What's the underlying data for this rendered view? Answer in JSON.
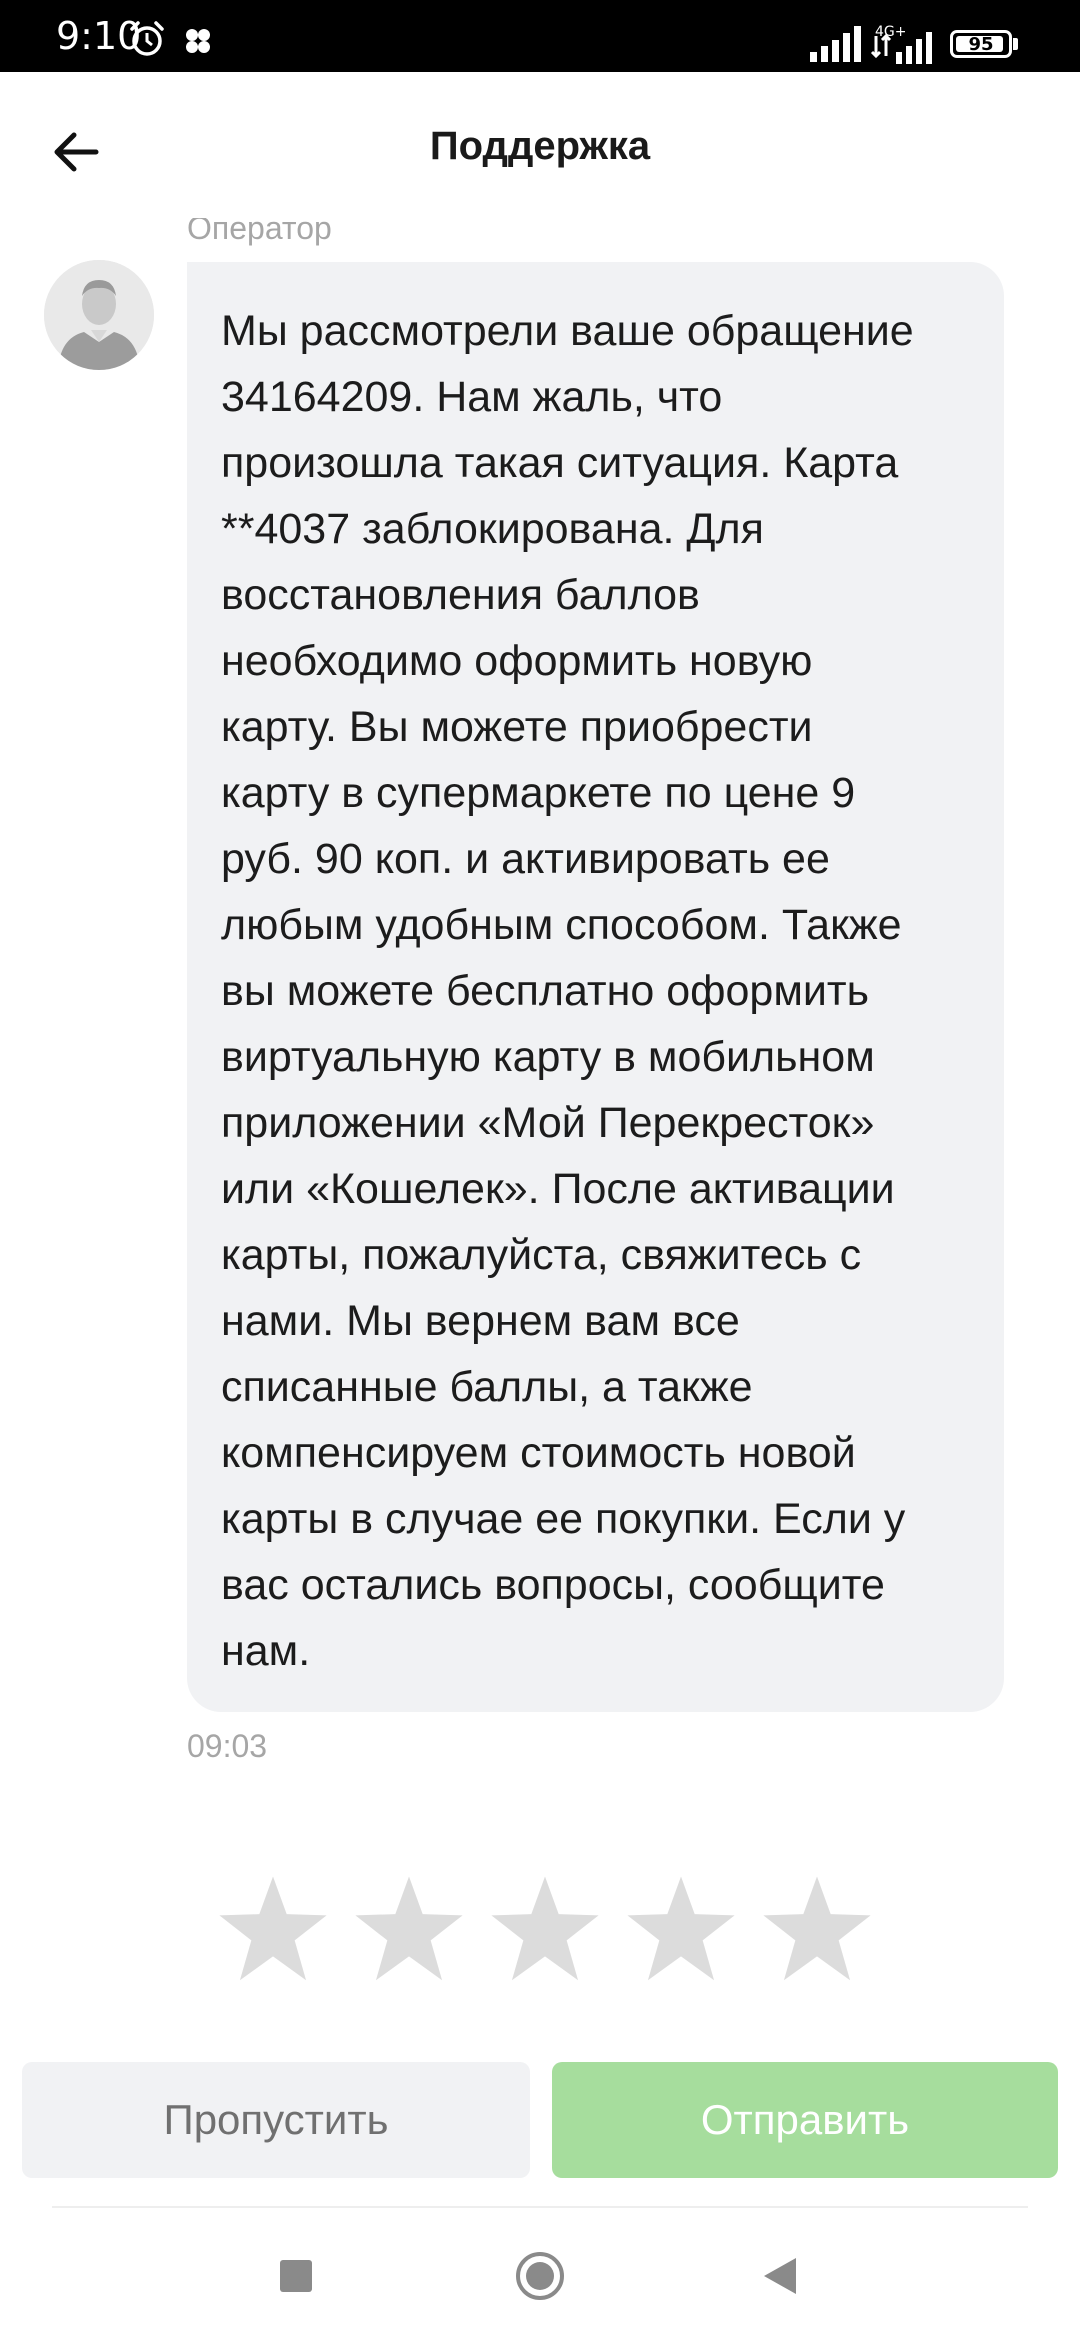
{
  "status_bar": {
    "time": "9:10",
    "network": "4G+",
    "battery": "95",
    "battery_level": 0.95,
    "icons": [
      "alarm-icon",
      "clover-icon",
      "signal-icon",
      "battery-icon"
    ]
  },
  "header": {
    "title": "Поддержка",
    "back_icon": "arrow-left-icon"
  },
  "chat": {
    "sender": "Оператор",
    "avatar_icon": "user-avatar-icon",
    "message": "Мы рассмотрели ваше обращение\n34164209. Нам жаль, что\nпроизошла такая ситуация. Карта\n**4037 заблокирована. Для\nвосстановления баллов\nнеобходимо оформить новую\nкарту. Вы можете приобрести\nкарту в супермаркете по цене 9\nруб. 90 коп. и активировать ее\nлюбым удобным способом. Также\nвы можете бесплатно оформить\nвиртуальную карту в мобильном\nприложении «Мой Перекресток»\nили «Кошелек». После активации\nкарты, пожалуйста, свяжитесь с\nнами. Мы вернем вам все\nсписанные баллы, а также\nкомпенсируем стоимость новой\nкарты в случае ее покупки. Если у\nвас остались вопросы, сообщите\nнам.",
    "time": "09:03"
  },
  "rating": {
    "max_stars": 5,
    "selected": 0,
    "star_icon": "star-icon"
  },
  "actions": {
    "skip_label": "Пропустить",
    "send_label": "Отправить"
  },
  "colors": {
    "bubble_bg": "#f1f2f4",
    "send_button": "#a6dd9d",
    "skip_button": "#f1f2f4",
    "star_empty": "#dcdcdc",
    "muted_text": "#a6a6a6"
  },
  "nav_bar": {
    "icons": [
      "recents-square-icon",
      "home-circle-icon",
      "back-triangle-icon"
    ]
  }
}
